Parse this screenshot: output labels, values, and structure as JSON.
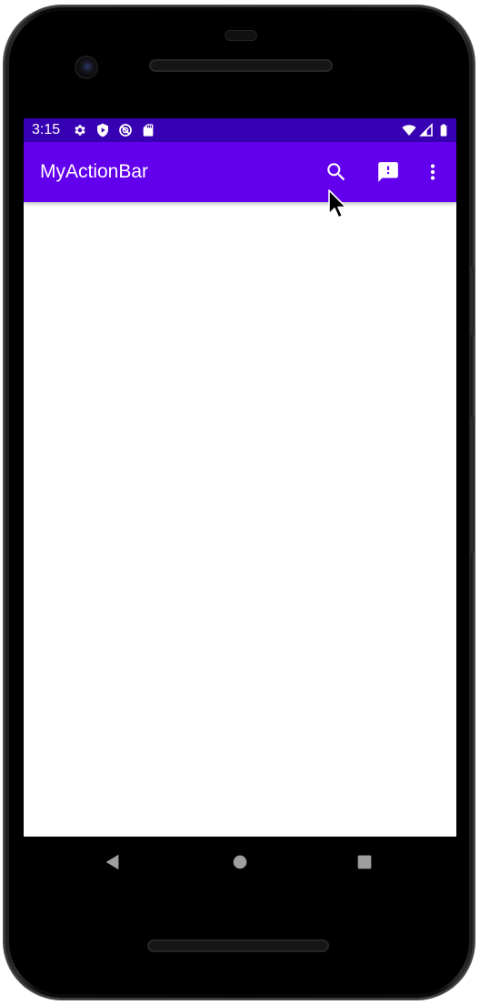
{
  "status_bar": {
    "time": "3:15",
    "left_icons": [
      "gear-icon",
      "shield-play-icon",
      "no-sync-icon",
      "sd-card-icon"
    ],
    "right_icons": [
      "wifi-icon",
      "signal-icon",
      "battery-icon"
    ],
    "color": "#3700b3"
  },
  "app_bar": {
    "title": "MyActionBar",
    "color": "#6200ee",
    "actions": [
      "search-icon",
      "feedback-icon",
      "overflow-menu-icon"
    ]
  },
  "nav_bar": {
    "buttons": [
      "back-icon",
      "home-icon",
      "recents-icon"
    ]
  }
}
